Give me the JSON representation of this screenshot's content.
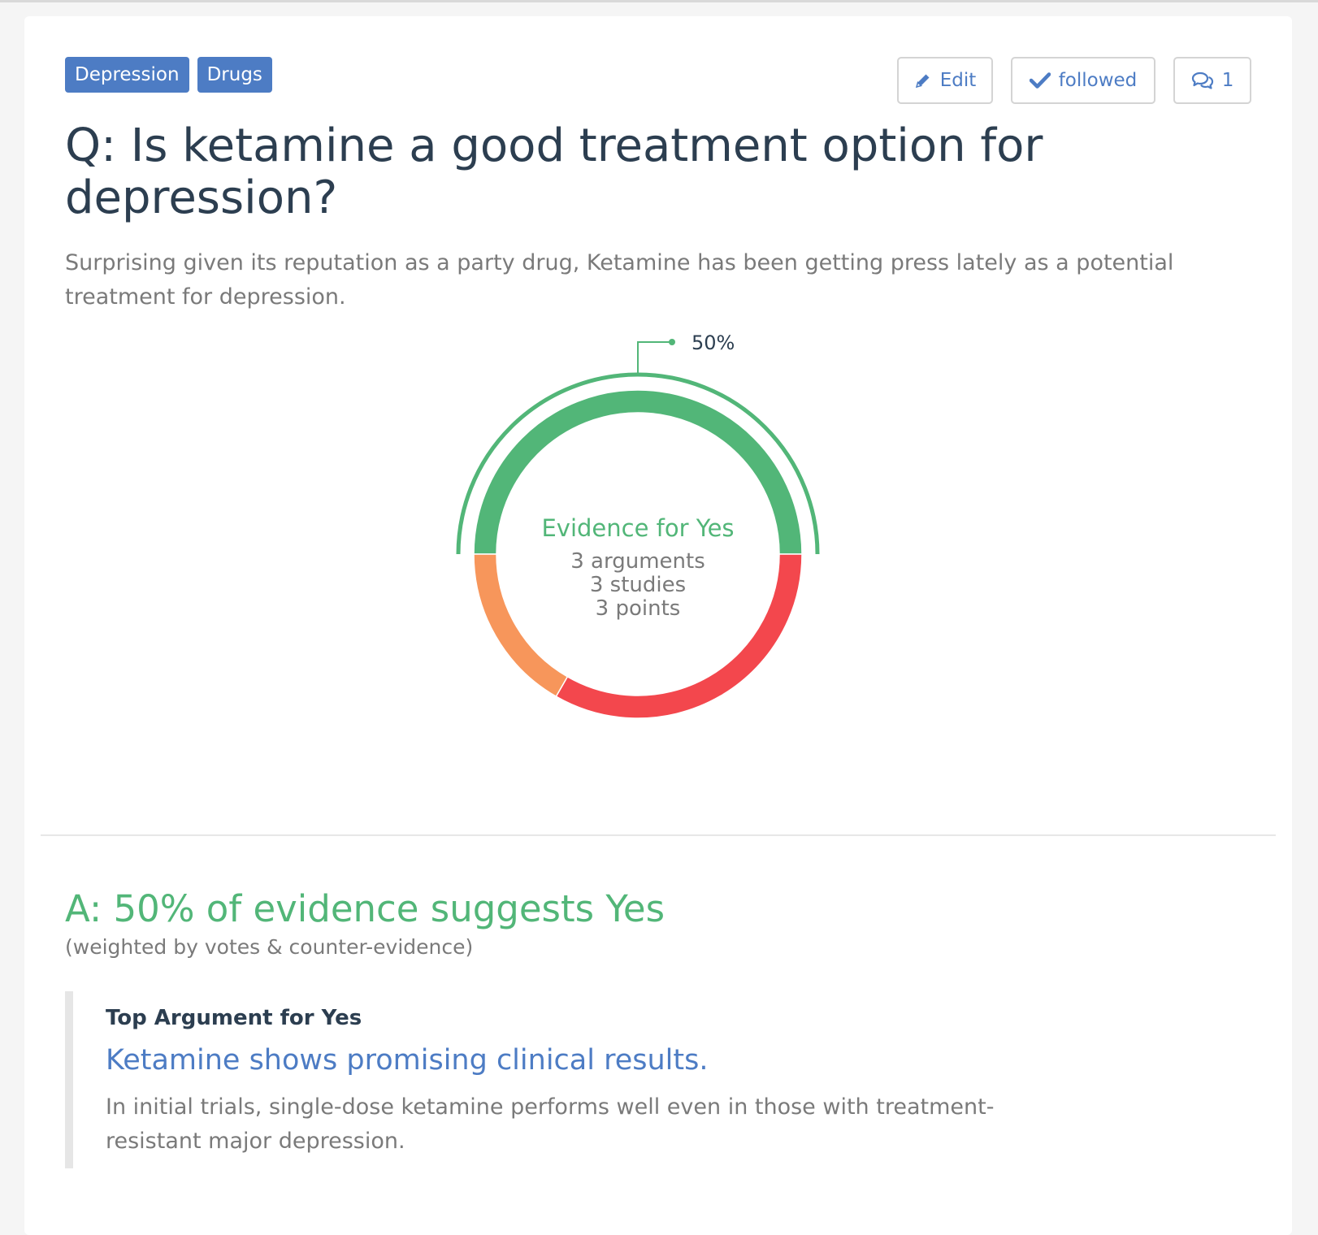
{
  "tags": [
    "Depression",
    "Drugs"
  ],
  "actions": {
    "edit_label": "Edit",
    "follow_label": "followed",
    "comment_count": "1"
  },
  "question": {
    "title": "Q: Is ketamine a good treatment option for depression?",
    "description": "Surprising given its reputation as a party drug, Ketamine has been getting press lately as a potential treatment for depression."
  },
  "chart_data": {
    "type": "pie",
    "style": "donut",
    "callout_label": "50%",
    "slices": [
      {
        "category": "yes",
        "value": 50,
        "color": "#52b678"
      },
      {
        "category": "no",
        "value": 33.3,
        "color": "#f3474d"
      },
      {
        "category": "neutral",
        "value": 16.7,
        "color": "#f7965b"
      }
    ],
    "center": {
      "heading": "Evidence for Yes",
      "lines": [
        "3 arguments",
        "3 studies",
        "3 points"
      ]
    }
  },
  "answer": {
    "headline": "A: 50% of evidence suggests Yes",
    "subtext": "(weighted by votes & counter-evidence)"
  },
  "top_argument": {
    "heading": "Top Argument for Yes",
    "title": "Ketamine shows promising clinical results.",
    "body": "In initial trials, single-dose ketamine performs well even in those with treatment-resistant major depression."
  },
  "colors": {
    "accent": "#4d7cc4",
    "yes": "#52b678",
    "no": "#f3474d",
    "neutral": "#f7965b",
    "text": "#2c3e50",
    "muted": "#7a7a7a"
  }
}
